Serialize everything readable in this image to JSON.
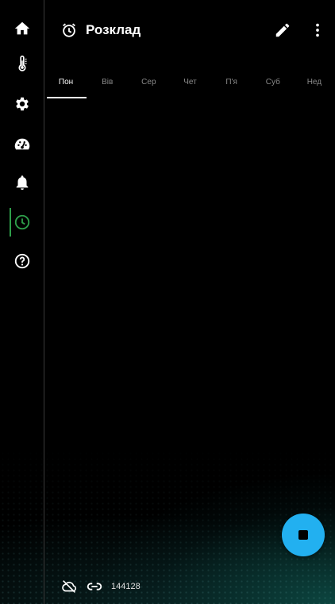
{
  "header": {
    "title": "Розклад",
    "title_icon": "schedule-icon",
    "edit_icon": "pencil-icon",
    "menu_icon": "more-vert-icon"
  },
  "sidebar": {
    "items": [
      {
        "icon": "home-icon"
      },
      {
        "icon": "thermometer-icon"
      },
      {
        "icon": "gear-icon"
      },
      {
        "icon": "speedometer-icon"
      },
      {
        "icon": "bell-icon"
      },
      {
        "icon": "clock-icon",
        "active": true
      },
      {
        "icon": "help-icon"
      }
    ]
  },
  "tabs": [
    {
      "label": "Пон",
      "active": true
    },
    {
      "label": "Вів"
    },
    {
      "label": "Сер"
    },
    {
      "label": "Чет"
    },
    {
      "label": "П'я"
    },
    {
      "label": "Суб"
    },
    {
      "label": "Нед"
    }
  ],
  "fab": {
    "icon": "stop-icon"
  },
  "status": {
    "cloud_icon": "cloud-off-icon",
    "link_icon": "link-icon",
    "device_id": "144128"
  },
  "colors": {
    "background": "#000000",
    "active_accent": "#2e9e4a",
    "fab": "#22b0f0"
  }
}
